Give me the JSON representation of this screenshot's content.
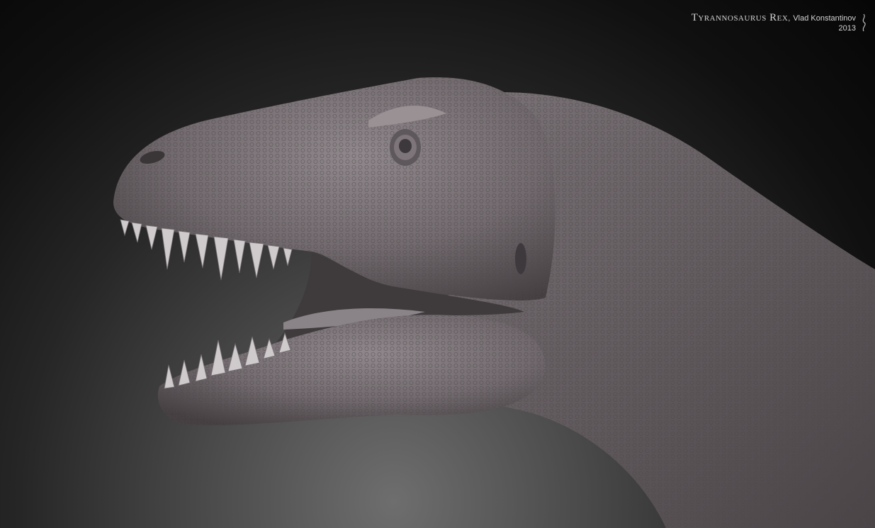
{
  "credit": {
    "title": "Tyrannosaurus Rex",
    "separator": ",",
    "author": "Vlad Konstantinov",
    "year": "2013"
  },
  "colors": {
    "skin_light": "#8c8388",
    "skin_mid": "#6f676b",
    "skin_dark": "#3e3a3c",
    "mouth_inner": "#4a4648",
    "teeth": "#cfcacc"
  }
}
